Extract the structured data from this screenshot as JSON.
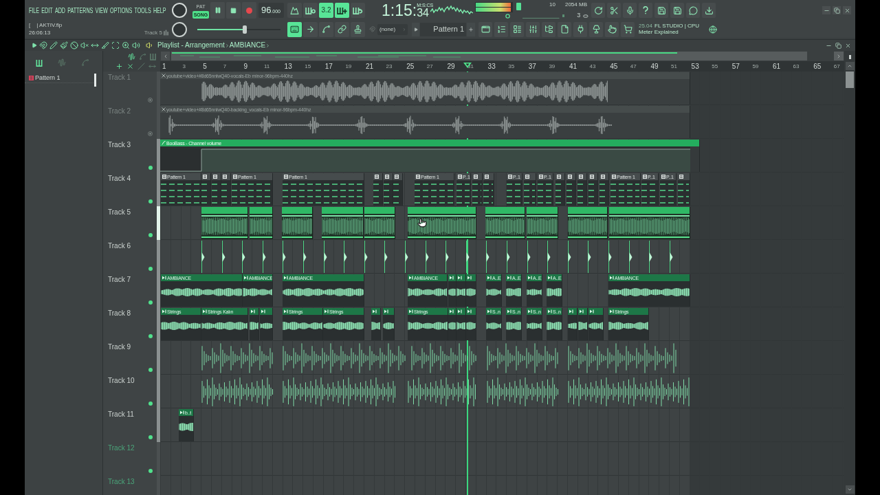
{
  "menu": [
    "FILE",
    "EDIT",
    "ADD",
    "PATTERNS",
    "VIEW",
    "OPTIONS",
    "TOOLS",
    "HELP"
  ],
  "project": {
    "bracket": "[",
    "file": "| AKTIV.flp",
    "time": "26:06:13",
    "focus": "Track 5"
  },
  "mode_switch": [
    {
      "label": "PAT",
      "selected": false
    },
    {
      "label": "SONG",
      "selected": true
    }
  ],
  "tempo": {
    "whole": "96",
    "fraction": ".000"
  },
  "tools_top": [
    {
      "on": false
    },
    {
      "on": false
    },
    {
      "on": true,
      "label": "3.2"
    },
    {
      "on": true
    },
    {
      "on": false
    }
  ],
  "clock": {
    "main": "1:15:",
    "small": "34",
    "format": "M:S:CS"
  },
  "peak_meter": {
    "level": 0.97
  },
  "stats": {
    "voices": "10",
    "memory": "2054 MB",
    "cpu": "3"
  },
  "master_volume": {
    "level": 0.57
  },
  "tools_bottom": [
    {
      "on": true
    },
    {
      "on": false
    },
    {
      "on": false
    },
    {
      "on": false
    },
    {
      "on": false
    }
  ],
  "snap": {
    "value": "(none)"
  },
  "pattern_picker": {
    "value": "Pattern 1"
  },
  "hint_bar": {
    "version": "25.04",
    "title": "FL STUDIO | CPU",
    "subtitle": "Meter Explained"
  },
  "playlist": {
    "title": "Playlist - Arrangement",
    "crumb": "AMBIANCE",
    "patterns": [
      {
        "label": "Pattern 1"
      }
    ],
    "ruler": [
      "1",
      "3",
      "5",
      "7",
      "9",
      "11",
      "13",
      "15",
      "17",
      "19",
      "21",
      "23",
      "25",
      "27",
      "29",
      "31",
      "33",
      "35",
      "37",
      "39",
      "41",
      "43",
      "45",
      "47",
      "49",
      "51",
      "53",
      "55",
      "57",
      "59",
      "61",
      "63",
      "65",
      "67"
    ],
    "tracks": [
      {
        "name": "Track 1",
        "kind": "vocal",
        "muted": true,
        "selected": false,
        "clips": [
          "youtube+video+#8d65nnlwQ40-vocals-Eb minor-96bpm-440hz"
        ]
      },
      {
        "name": "Track 2",
        "kind": "vocal_sparse",
        "muted": true,
        "selected": false,
        "clips": [
          "youtube+video+#8d65nnlwQ40-backing_vocals-Eb minor-96bpm-440hz"
        ]
      },
      {
        "name": "Track 3",
        "kind": "automation",
        "muted": false,
        "selected": false,
        "clips": [
          "BooBass - Channel volume"
        ]
      },
      {
        "name": "Track 4",
        "kind": "pattern",
        "muted": false,
        "selected": false,
        "clips": [
          "Pattern 1",
          "Pattern 1",
          "Pattern 1",
          "Pattern 1",
          "P..1",
          "P..1",
          "P..1",
          "Pattern 1",
          "P..1",
          "P..1"
        ]
      },
      {
        "name": "Track 5",
        "kind": "loop",
        "muted": false,
        "selected": true
      },
      {
        "name": "Track 6",
        "kind": "hits",
        "muted": false,
        "selected": false
      },
      {
        "name": "Track 7",
        "kind": "audio",
        "muted": false,
        "selected": false,
        "clips": [
          "AMBIANCE",
          "AMBIANCE",
          "AMBIANCE",
          "AMBIANCE",
          "A..E",
          "A..E",
          "A..E",
          "A..E",
          "AMBIANCE"
        ]
      },
      {
        "name": "Track 8",
        "kind": "audio",
        "muted": false,
        "selected": false,
        "clips": [
          "Strings",
          "Strings Kalın",
          "Strings",
          "Strings",
          "Strings",
          "S..n",
          "S..n",
          "S..n",
          "S..n",
          "Strings"
        ]
      },
      {
        "name": "Track 9",
        "kind": "transients",
        "muted": false,
        "selected": false
      },
      {
        "name": "Track 10",
        "kind": "hats",
        "muted": false,
        "selected": false
      },
      {
        "name": "Track 11",
        "kind": "audio",
        "muted": false,
        "selected": false,
        "clips": [
          "b..t"
        ]
      },
      {
        "name": "Track 12",
        "kind": "empty",
        "muted": false,
        "selected": false
      },
      {
        "name": "Track 13",
        "kind": "empty",
        "selected": false
      }
    ]
  }
}
